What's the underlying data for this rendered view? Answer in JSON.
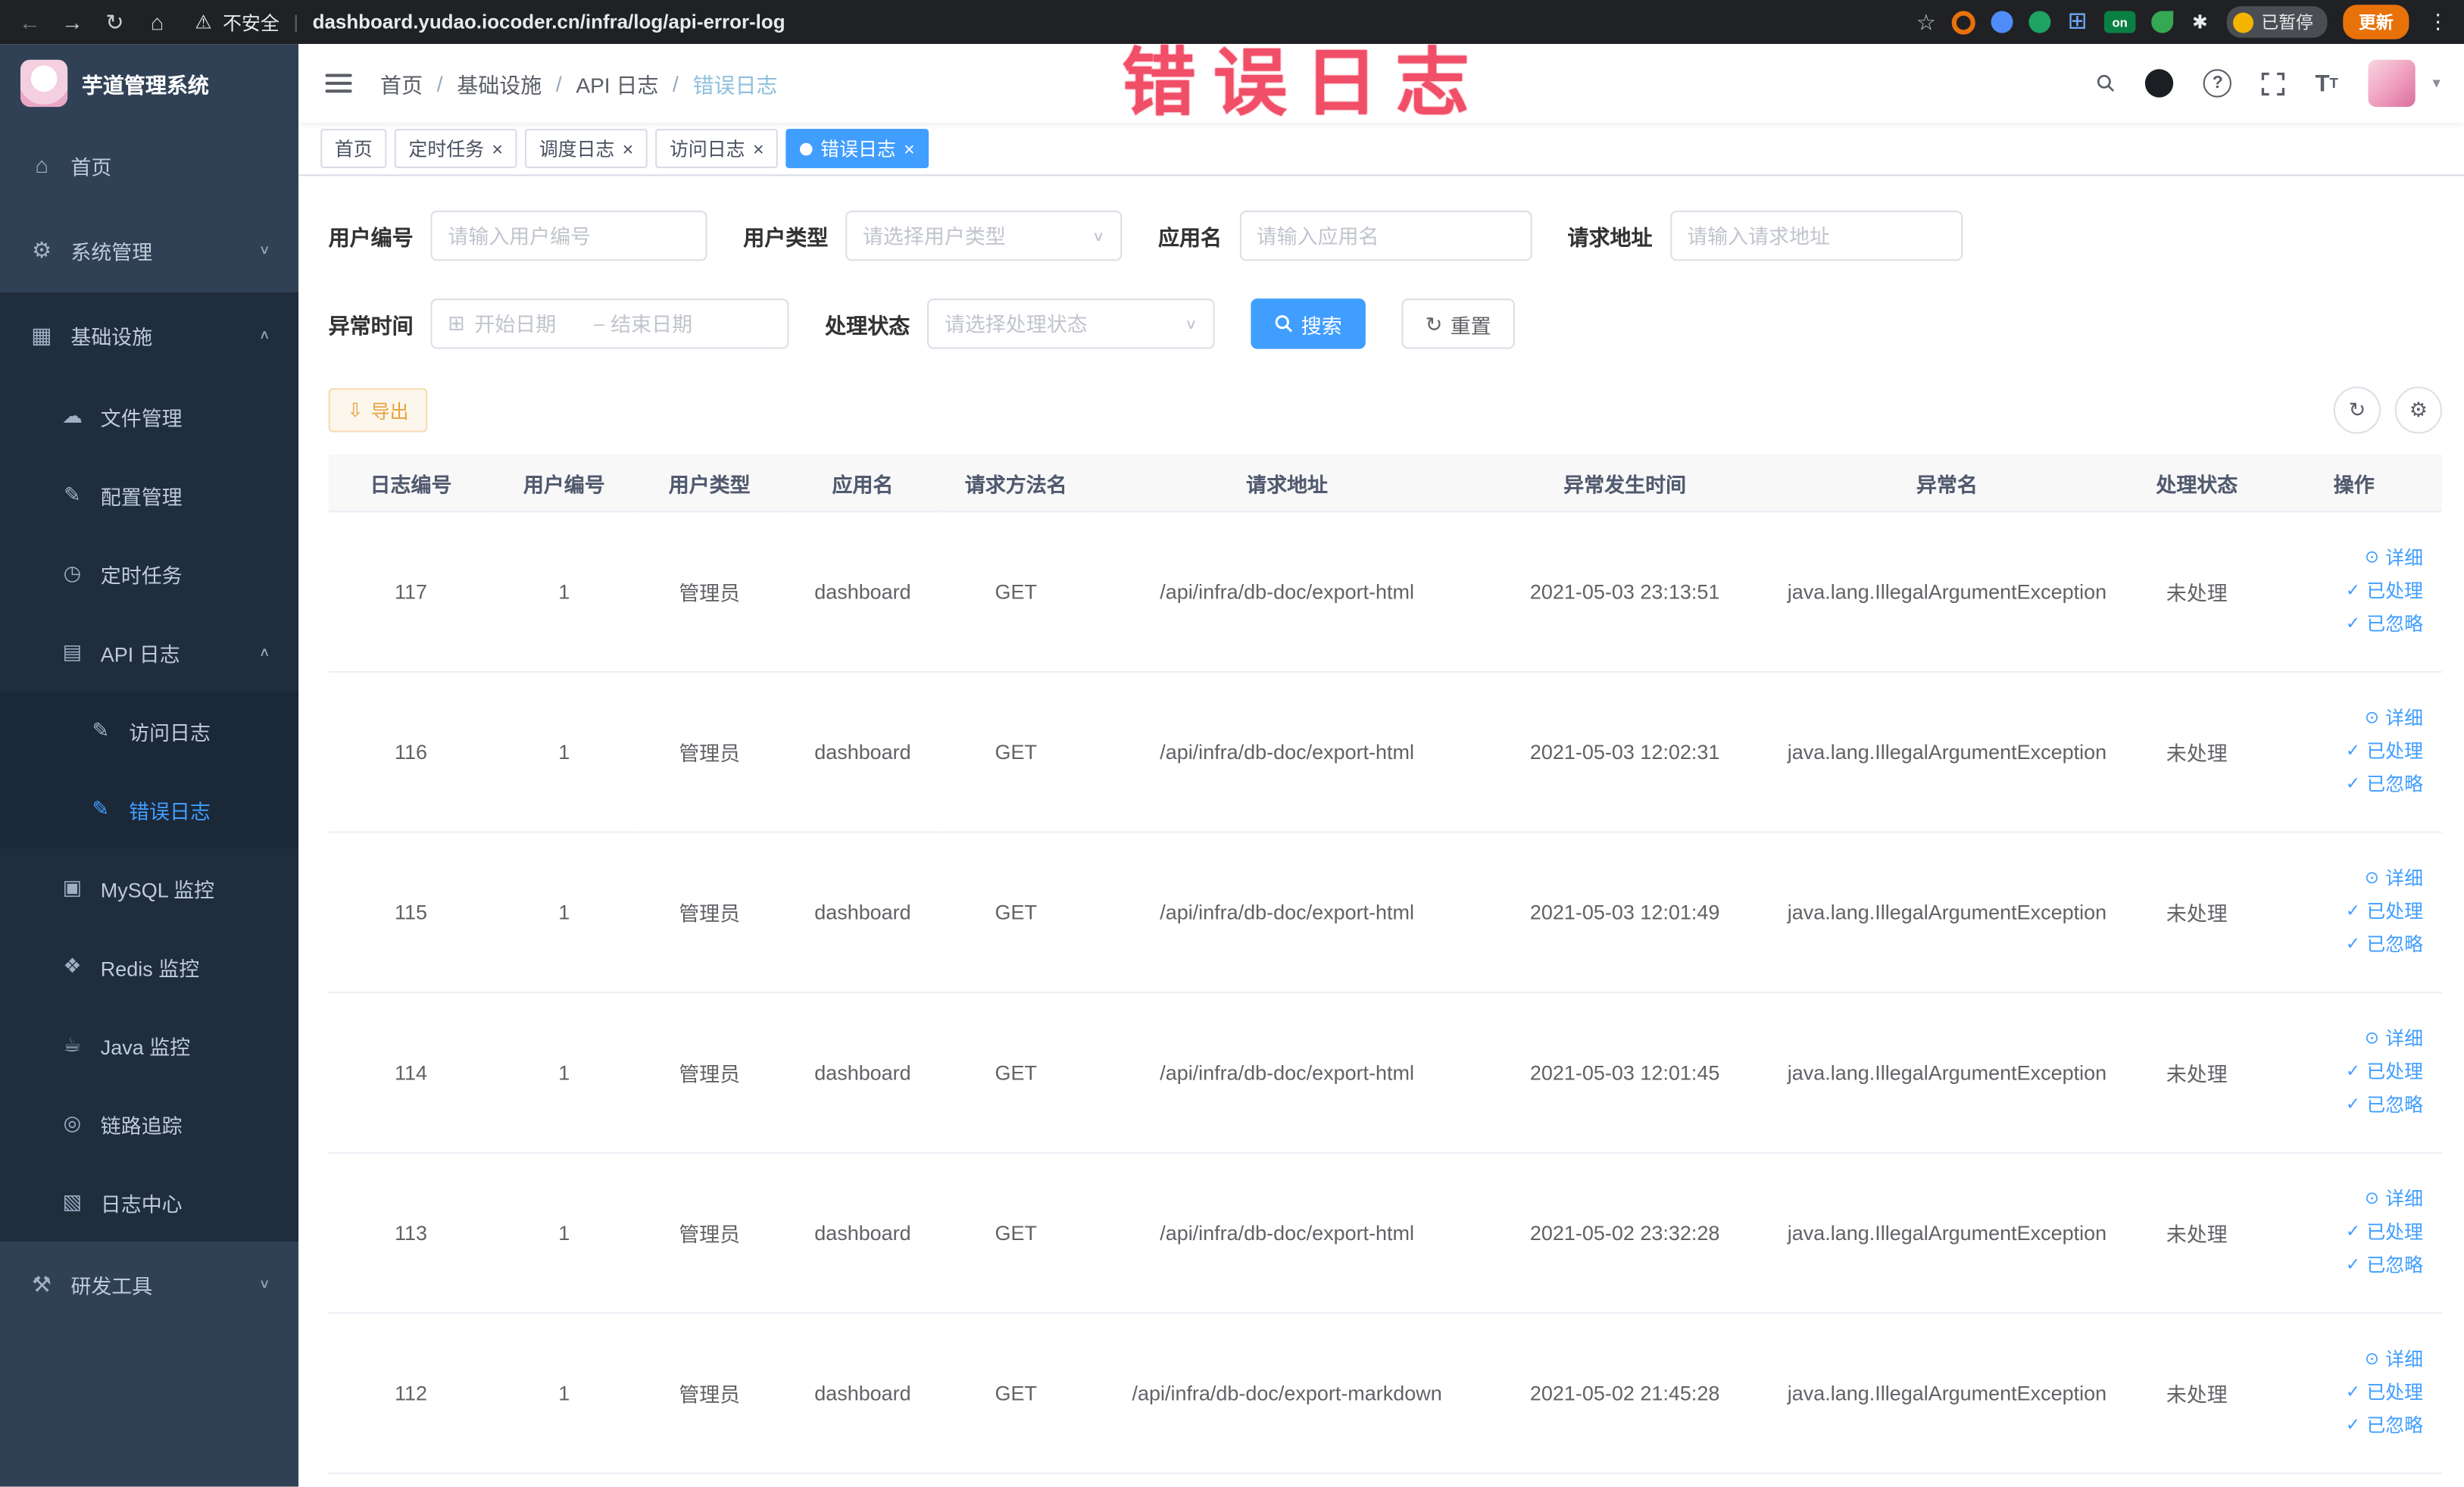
{
  "browser": {
    "security_label": "不安全",
    "url": "dashboard.yudao.iocoder.cn/infra/log/api-error-log",
    "paused_badge": "已暂停",
    "update_button": "更新"
  },
  "annotation": "错误日志",
  "sidebar": {
    "logo_title": "芋道管理系统",
    "items": [
      {
        "label": "首页"
      },
      {
        "label": "系统管理"
      },
      {
        "label": "基础设施"
      },
      {
        "label": "文件管理"
      },
      {
        "label": "配置管理"
      },
      {
        "label": "定时任务"
      },
      {
        "label": "API 日志"
      },
      {
        "label": "访问日志"
      },
      {
        "label": "错误日志"
      },
      {
        "label": "MySQL 监控"
      },
      {
        "label": "Redis 监控"
      },
      {
        "label": "Java 监控"
      },
      {
        "label": "链路追踪"
      },
      {
        "label": "日志中心"
      },
      {
        "label": "研发工具"
      }
    ]
  },
  "breadcrumb": {
    "items": [
      "首页",
      "基础设施",
      "API 日志",
      "错误日志"
    ]
  },
  "tabs": [
    {
      "label": "首页"
    },
    {
      "label": "定时任务"
    },
    {
      "label": "调度日志"
    },
    {
      "label": "访问日志"
    },
    {
      "label": "错误日志"
    }
  ],
  "filters": {
    "user_id_label": "用户编号",
    "user_id_placeholder": "请输入用户编号",
    "user_type_label": "用户类型",
    "user_type_placeholder": "请选择用户类型",
    "app_name_label": "应用名",
    "app_name_placeholder": "请输入应用名",
    "request_url_label": "请求地址",
    "request_url_placeholder": "请输入请求地址",
    "exception_time_label": "异常时间",
    "start_date_placeholder": "开始日期",
    "end_date_placeholder": "结束日期",
    "process_status_label": "处理状态",
    "process_status_placeholder": "请选择处理状态",
    "search_label": "搜索",
    "reset_label": "重置"
  },
  "toolbar": {
    "export_label": "导出"
  },
  "table": {
    "columns": [
      "日志编号",
      "用户编号",
      "用户类型",
      "应用名",
      "请求方法名",
      "请求地址",
      "异常发生时间",
      "异常名",
      "处理状态",
      "操作"
    ],
    "actions": {
      "detail": "详细",
      "processed": "已处理",
      "ignored": "已忽略"
    },
    "rows": [
      {
        "log_id": "117",
        "user_id": "1",
        "user_type": "管理员",
        "app_name": "dashboard",
        "method": "GET",
        "request_url": "/api/infra/db-doc/export-html",
        "exception_time": "2021-05-03 23:13:51",
        "exception_name": "java.lang.IllegalArgumentException",
        "status": "未处理"
      },
      {
        "log_id": "116",
        "user_id": "1",
        "user_type": "管理员",
        "app_name": "dashboard",
        "method": "GET",
        "request_url": "/api/infra/db-doc/export-html",
        "exception_time": "2021-05-03 12:02:31",
        "exception_name": "java.lang.IllegalArgumentException",
        "status": "未处理"
      },
      {
        "log_id": "115",
        "user_id": "1",
        "user_type": "管理员",
        "app_name": "dashboard",
        "method": "GET",
        "request_url": "/api/infra/db-doc/export-html",
        "exception_time": "2021-05-03 12:01:49",
        "exception_name": "java.lang.IllegalArgumentException",
        "status": "未处理"
      },
      {
        "log_id": "114",
        "user_id": "1",
        "user_type": "管理员",
        "app_name": "dashboard",
        "method": "GET",
        "request_url": "/api/infra/db-doc/export-html",
        "exception_time": "2021-05-03 12:01:45",
        "exception_name": "java.lang.IllegalArgumentException",
        "status": "未处理"
      },
      {
        "log_id": "113",
        "user_id": "1",
        "user_type": "管理员",
        "app_name": "dashboard",
        "method": "GET",
        "request_url": "/api/infra/db-doc/export-html",
        "exception_time": "2021-05-02 23:32:28",
        "exception_name": "java.lang.IllegalArgumentException",
        "status": "未处理"
      },
      {
        "log_id": "112",
        "user_id": "1",
        "user_type": "管理员",
        "app_name": "dashboard",
        "method": "GET",
        "request_url": "/api/infra/db-doc/export-markdown",
        "exception_time": "2021-05-02 21:45:28",
        "exception_name": "java.lang.IllegalArgumentException",
        "status": "未处理"
      }
    ]
  }
}
